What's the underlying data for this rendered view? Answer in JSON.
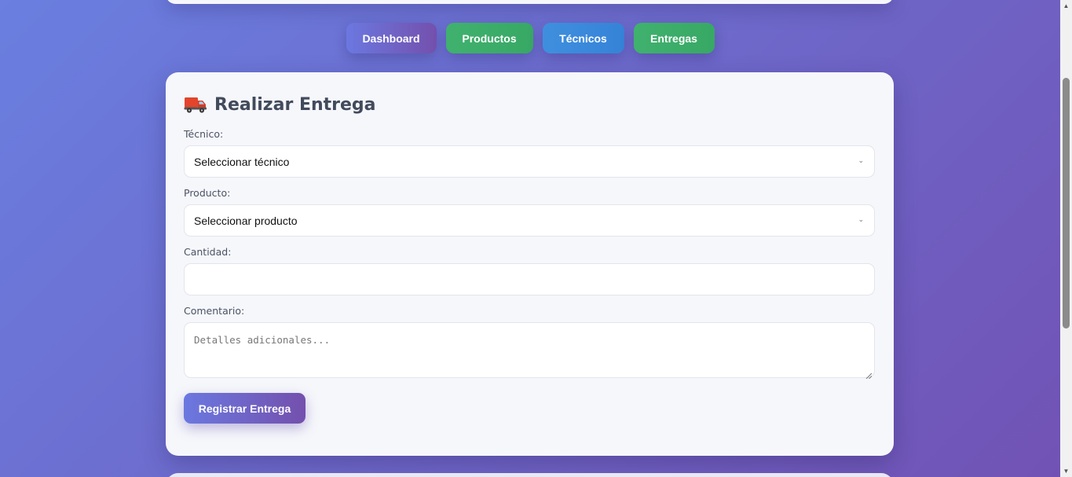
{
  "nav": {
    "items": [
      {
        "label": "Dashboard"
      },
      {
        "label": "Productos"
      },
      {
        "label": "Técnicos"
      },
      {
        "label": "Entregas"
      }
    ]
  },
  "form": {
    "title": "Realizar Entrega",
    "title_icon": "delivery-truck-icon",
    "tecnico_label": "Técnico:",
    "tecnico_selected": "Seleccionar técnico",
    "producto_label": "Producto:",
    "producto_selected": "Seleccionar producto",
    "cantidad_label": "Cantidad:",
    "cantidad_value": "",
    "comentario_label": "Comentario:",
    "comentario_placeholder": "Detalles adicionales...",
    "submit_label": "Registrar Entrega"
  },
  "colors": {
    "background_start": "#6a7fe0",
    "background_end": "#7152b4",
    "productos": "#40b16e",
    "tecnicos": "#3f8fde",
    "entregas": "#40b16e",
    "card": "#f6f7fb"
  }
}
